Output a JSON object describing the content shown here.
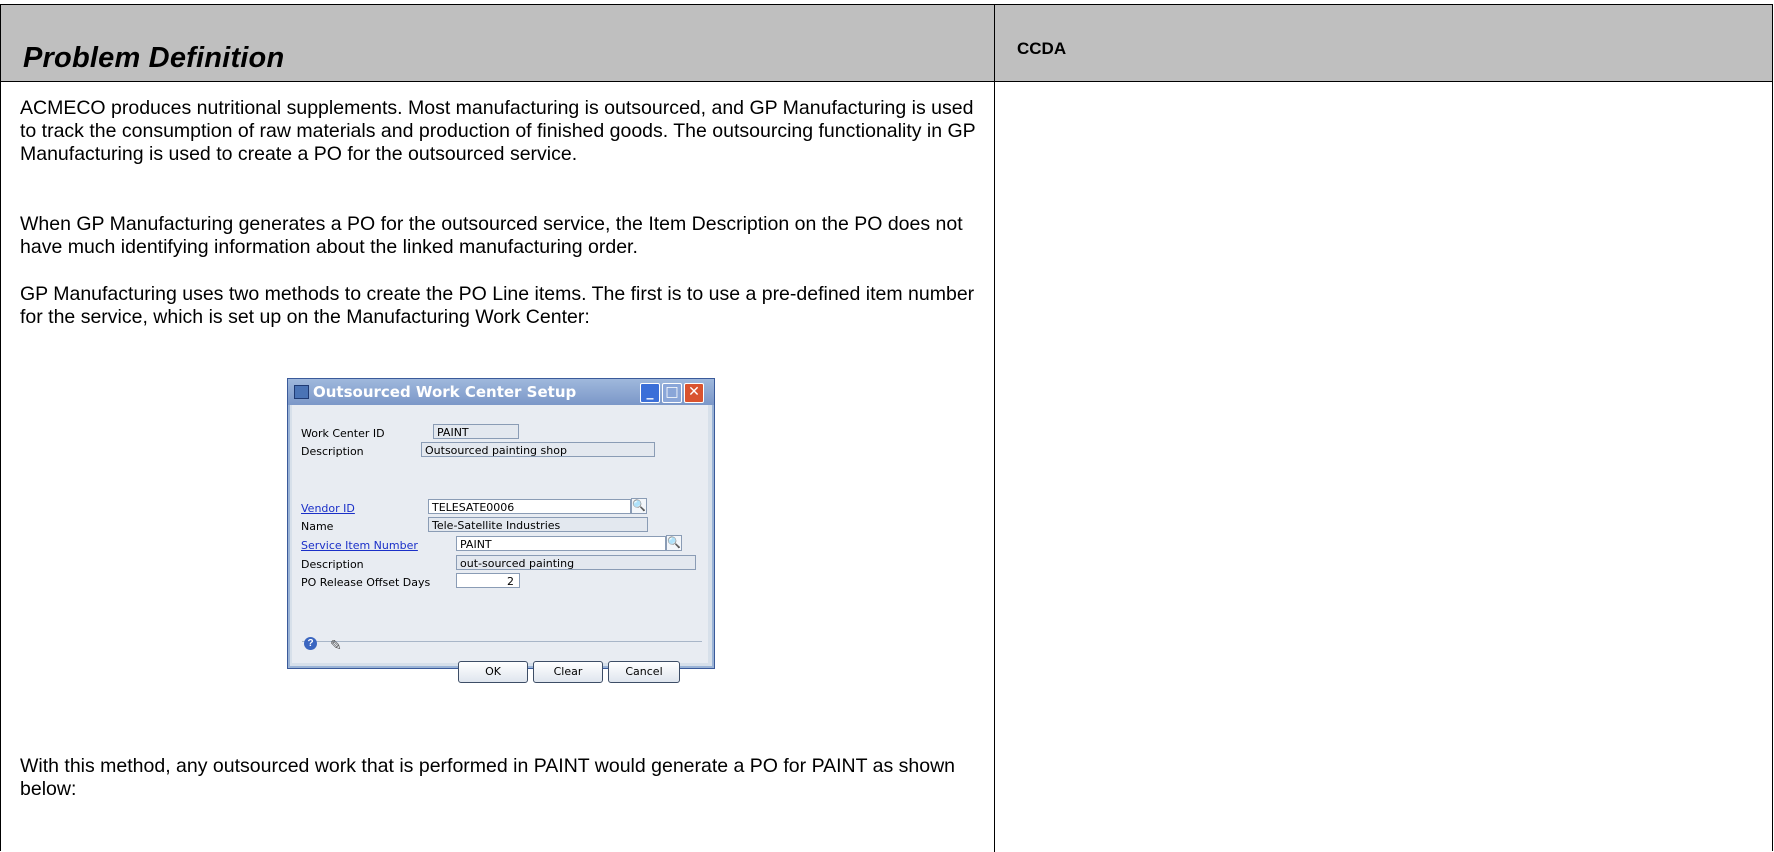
{
  "header": {
    "title": "Problem Definition",
    "side_title": "CCDA"
  },
  "paragraphs": [
    "ACMECO produces nutritional supplements.  Most manufacturing is outsourced, and GP Manufacturing is used to track the consumption of raw materials and production of finished goods.  The outsourcing functionality in GP Manufacturing is used to create a PO for the outsourced service.",
    "When GP Manufacturing generates a PO for the outsourced service, the Item Description on the PO does not have much identifying information about the linked manufacturing order.",
    "GP Manufacturing uses two methods to create the PO Line items. The first is to use a pre-defined item number for the service, which is set up on the Manufacturing Work Center:",
    "With this method, any outsourced work that is performed in PAINT would generate a PO for PAINT as shown below:"
  ],
  "dialog": {
    "title": "Outsourced Work Center Setup",
    "fields": {
      "work_center_id_label": "Work Center ID",
      "work_center_id_value": "PAINT",
      "description_label": "Description",
      "description_value": "Outsourced painting shop",
      "vendor_id_label": "Vendor ID",
      "vendor_id_value": "TELESATE0006",
      "name_label": "Name",
      "name_value": "Tele-Satellite Industries",
      "service_item_label": "Service Item Number",
      "service_item_value": "PAINT",
      "service_desc_label": "Description",
      "service_desc_value": "out-sourced painting",
      "offset_label": "PO Release Offset Days",
      "offset_value": "2"
    },
    "buttons": {
      "ok": "OK",
      "clear": "Clear",
      "cancel": "Cancel"
    },
    "icons": [
      "help-icon",
      "note-icon",
      "lookup-icon",
      "minimize-icon",
      "maximize-icon",
      "close-icon"
    ]
  }
}
